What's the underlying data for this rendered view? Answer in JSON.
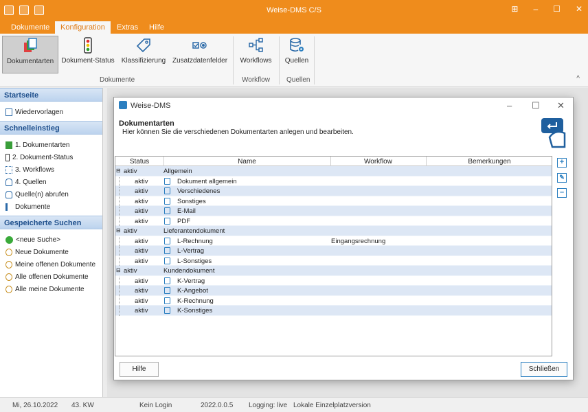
{
  "app": {
    "title": "Weise-DMS C/S"
  },
  "menu": {
    "items": [
      "Dokumente",
      "Konfiguration",
      "Extras",
      "Hilfe"
    ]
  },
  "ribbon": {
    "buttons": [
      "Dokumentarten",
      "Dokument-Status",
      "Klassifizierung",
      "Zusatzdatenfelder",
      "Workflows",
      "Quellen"
    ],
    "groups": [
      "Dokumente",
      "Workflow",
      "Quellen"
    ]
  },
  "sidebar": {
    "startseite": {
      "header": "Startseite",
      "items": [
        "Wiedervorlagen"
      ]
    },
    "schnell": {
      "header": "Schnelleinstieg",
      "items": [
        "1. Dokumentarten",
        "2. Dokument-Status",
        "3. Workflows",
        "4. Quellen",
        "Quelle(n) abrufen",
        "Dokumente"
      ]
    },
    "suchen": {
      "header": "Gespeicherte Suchen",
      "items": [
        "<neue Suche>",
        "Neue Dokumente",
        "Meine offenen Dokumente",
        "Alle offenen Dokumente",
        "Alle meine Dokumente"
      ]
    }
  },
  "dialog": {
    "title": "Weise-DMS",
    "heading": "Dokumentarten",
    "subtitle": "Hier können Sie die verschiedenen Dokumentarten anlegen und bearbeiten.",
    "columns": [
      "Status",
      "Name",
      "Workflow",
      "Bemerkungen"
    ],
    "rows": [
      {
        "group": true,
        "status": "aktiv",
        "name": "Allgemein",
        "workflow": ""
      },
      {
        "group": false,
        "status": "aktiv",
        "name": "Dokument allgemein",
        "workflow": ""
      },
      {
        "group": false,
        "status": "aktiv",
        "name": "Verschiedenes",
        "workflow": ""
      },
      {
        "group": false,
        "status": "aktiv",
        "name": "Sonstiges",
        "workflow": ""
      },
      {
        "group": false,
        "status": "aktiv",
        "name": "E-Mail",
        "workflow": ""
      },
      {
        "group": false,
        "status": "aktiv",
        "name": "PDF",
        "workflow": ""
      },
      {
        "group": true,
        "status": "aktiv",
        "name": "Lieferantendokument",
        "workflow": ""
      },
      {
        "group": false,
        "status": "aktiv",
        "name": "L-Rechnung",
        "workflow": "Eingangsrechnung"
      },
      {
        "group": false,
        "status": "aktiv",
        "name": "L-Vertrag",
        "workflow": ""
      },
      {
        "group": false,
        "status": "aktiv",
        "name": "L-Sonstiges",
        "workflow": ""
      },
      {
        "group": true,
        "status": "aktiv",
        "name": "Kundendokument",
        "workflow": ""
      },
      {
        "group": false,
        "status": "aktiv",
        "name": "K-Vertrag",
        "workflow": ""
      },
      {
        "group": false,
        "status": "aktiv",
        "name": "K-Angebot",
        "workflow": ""
      },
      {
        "group": false,
        "status": "aktiv",
        "name": "K-Rechnung",
        "workflow": ""
      },
      {
        "group": false,
        "status": "aktiv",
        "name": "K-Sonstiges",
        "workflow": ""
      }
    ],
    "help_button": "Hilfe",
    "close_button": "Schließen"
  },
  "statusbar": {
    "date": "Mi, 26.10.2022",
    "week": "43. KW",
    "login": "Kein Login",
    "version": "2022.0.0.5",
    "logging": "Logging: live",
    "mode": "Lokale Einzelplatzversion"
  },
  "colors": {
    "accent": "#ef8c1c",
    "sidebar_header": "#bcd3ee",
    "row_alt": "#dde7f5"
  }
}
